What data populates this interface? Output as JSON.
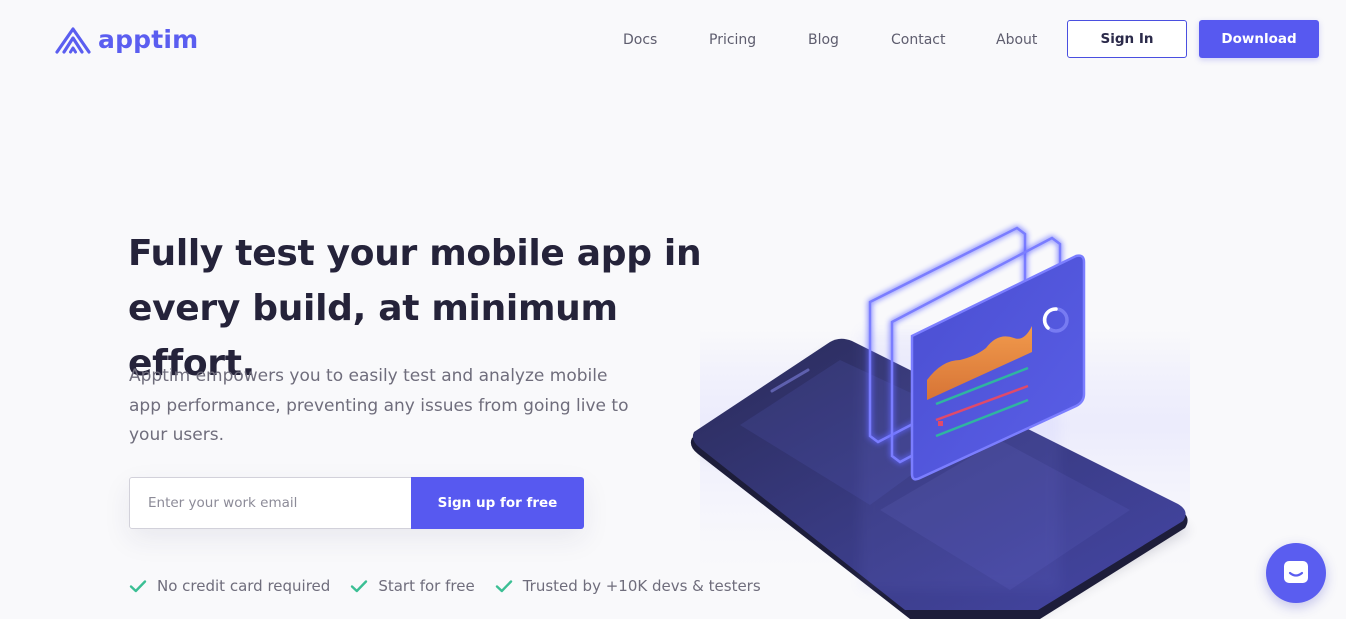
{
  "brand": {
    "name": "apptim",
    "accent": "#5759f0",
    "text_dark": "#25233a",
    "check_green": "#3bbf94"
  },
  "nav": {
    "links": [
      {
        "label": "Docs"
      },
      {
        "label": "Pricing"
      },
      {
        "label": "Blog"
      },
      {
        "label": "Contact"
      },
      {
        "label": "About"
      }
    ],
    "signin_label": "Sign In",
    "download_label": "Download"
  },
  "hero": {
    "title": "Fully test your mobile app in every build, at minimum effort.",
    "description": "Apptim empowers you to easily test and analyze mobile app performance, preventing any issues from going live to your users.",
    "email_placeholder": "Enter your work email",
    "email_value": "",
    "signup_label": "Sign up for free",
    "features": [
      {
        "label": "No credit card required",
        "icon": "check-icon"
      },
      {
        "label": "Start for free",
        "icon": "check-icon"
      },
      {
        "label": "Trusted by +10K devs & testers",
        "icon": "check-icon"
      }
    ]
  },
  "illustration": {
    "icon": "phone-performance-illustration"
  },
  "chat": {
    "icon": "chat-bubble-icon"
  }
}
